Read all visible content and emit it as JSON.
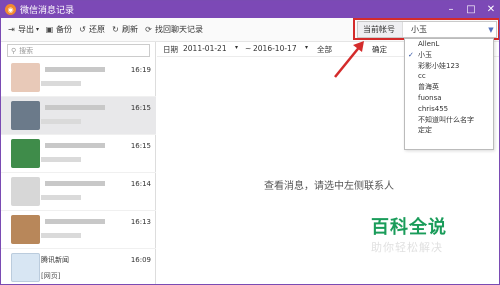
{
  "window": {
    "title": "微信消息记录",
    "minimize": "–",
    "maximize": "□",
    "close": "✕"
  },
  "toolbar": {
    "export_label": "导出",
    "backup_label": "备份",
    "restore_label": "还原",
    "refresh_label": "刷新",
    "find_label": "找回聊天记录",
    "account_label": "当前帐号",
    "account_value": "小玉"
  },
  "search": {
    "placeholder": "搜索"
  },
  "contacts": [
    {
      "time": "16:19"
    },
    {
      "time": "16:15"
    },
    {
      "time": "16:15"
    },
    {
      "time": "16:14"
    },
    {
      "time": "16:13"
    },
    {
      "name": "腾讯新闻",
      "preview": "[网页]",
      "time": "16:09"
    }
  ],
  "filter": {
    "date_label": "日期",
    "date_from": "2011-01-21",
    "date_sep": "~",
    "date_to": "2016-10-17",
    "type_value": "全部",
    "confirm_label": "确定"
  },
  "main": {
    "empty_message": "查看消息，请选中左侧联系人"
  },
  "account_dropdown": {
    "items": [
      "AllenL",
      "小玉",
      "彩影小娃123",
      "cc",
      "曾海英",
      "fuonsa",
      "chris455",
      "不知道叫什么名字",
      "定定"
    ],
    "selected_index": 1
  },
  "watermark": {
    "title": "百科全说",
    "subtitle": "助你轻松解决"
  },
  "colors": {
    "titlebar": "#7c49b6",
    "accent_red": "#d42b2b",
    "watermark_green": "#1a9c5a"
  }
}
